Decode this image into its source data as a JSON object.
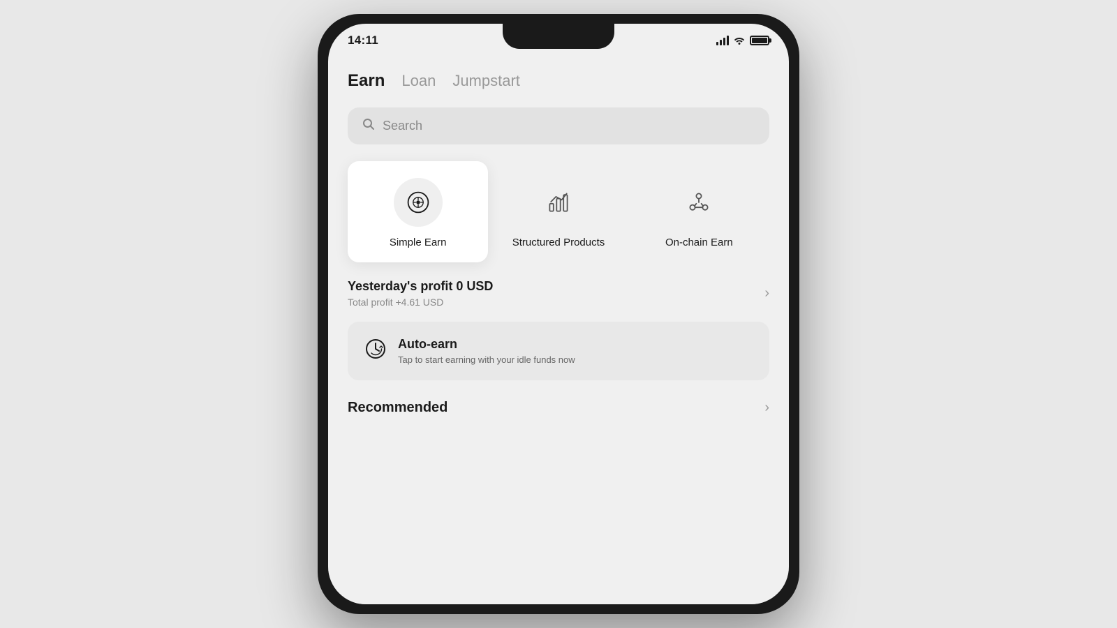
{
  "statusBar": {
    "time": "14:11",
    "icons": {
      "signal": "signal",
      "wifi": "wifi",
      "battery": "battery"
    }
  },
  "nav": {
    "tabs": [
      {
        "label": "Earn",
        "active": true
      },
      {
        "label": "Loan",
        "active": false
      },
      {
        "label": "Jumpstart",
        "active": false
      }
    ]
  },
  "search": {
    "placeholder": "Search"
  },
  "products": [
    {
      "label": "Simple Earn",
      "active": true,
      "icon": "bag"
    },
    {
      "label": "Structured Products",
      "active": false,
      "icon": "chart"
    },
    {
      "label": "On-chain Earn",
      "active": false,
      "icon": "nodes"
    }
  ],
  "profit": {
    "title": "Yesterday's profit 0 USD",
    "subtitle": "Total profit +4.61 USD"
  },
  "autoEarn": {
    "title": "Auto-earn",
    "subtitle": "Tap to start earning with your idle funds now"
  },
  "recommended": {
    "title": "Recommended"
  }
}
